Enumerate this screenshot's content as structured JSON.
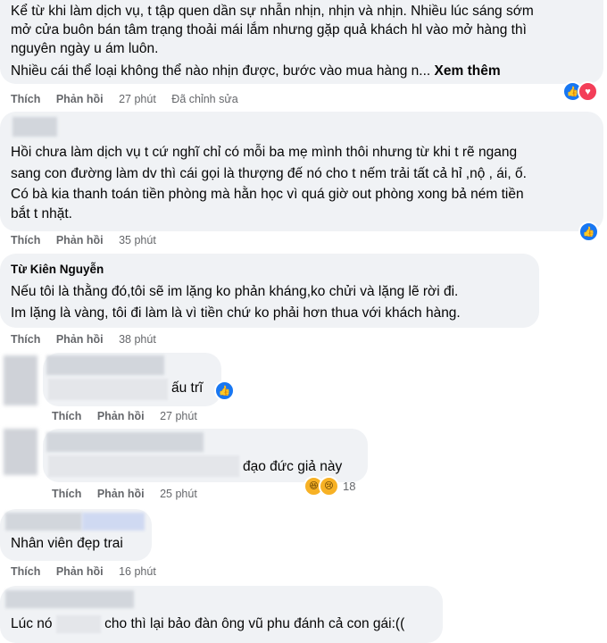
{
  "comments": [
    {
      "lines": [
        "Kể từ khi làm dịch vụ, t tập quen dần sự nhẫn nhịn, nhịn và nhịn. Nhiều lúc sáng sớm",
        "mở cửa buôn bán tâm trạng thoải mái lắm nhưng gặp quả khách hl vào mở hàng thì",
        "nguyên ngày u ám luôn.",
        "Nhiều cái thể loại không thể nào nhịn được, bước vào mua hàng n..."
      ],
      "see_more": "Xem thêm",
      "like": "Thích",
      "reply": "Phản hồi",
      "time": "27 phút",
      "edited": "Đã chỉnh sửa",
      "reactions": [
        "like",
        "love"
      ]
    },
    {
      "lines": [
        "Hồi chưa làm dịch vụ t cứ nghĩ chỉ có mỗi ba mẹ mình thôi nhưng từ khi t rẽ ngang",
        "sang con đường làm dv thì cái gọi là thượng đế nó cho t nếm trải tất cả hỉ ,nộ , ái, ố.",
        "Có bà kia thanh toán tiền phòng mà hằn học vì quá giờ out phòng xong bả ném tiền",
        "bắt t nhặt."
      ],
      "like": "Thích",
      "reply": "Phản hồi",
      "time": "35 phút",
      "reactions": [
        "like"
      ]
    },
    {
      "author": "Từ Kiên Nguyễn",
      "lines": [
        "Nếu tôi là thằng đó,tôi sẽ im lặng ko phản kháng,ko chửi và lặng lẽ rời đi.",
        "Im lặng là vàng, tôi đi làm là vì tiền chứ ko phải hơn thua với khách hàng."
      ],
      "like": "Thích",
      "reply": "Phản hồi",
      "time": "38 phút"
    },
    {
      "lines": [
        "ấu trĩ"
      ],
      "like": "Thích",
      "reply": "Phản hồi",
      "time": "27 phút",
      "reactions": [
        "like"
      ]
    },
    {
      "lines": [
        "đạo đức giả này"
      ],
      "like": "Thích",
      "reply": "Phản hồi",
      "time": "25 phút",
      "reactions": [
        "haha",
        "sad"
      ],
      "reaction_count": "18"
    },
    {
      "lines": [
        "Nhân viên đẹp trai"
      ],
      "like": "Thích",
      "reply": "Phản hồi",
      "time": "16 phút"
    },
    {
      "lines_parts": [
        "Lúc nó",
        "cho thì lại bảo đàn ông vũ phu đánh cả con gái:(("
      ]
    }
  ],
  "colors": {
    "bubble": "#f0f2f5",
    "like_blue": "#1877f2",
    "love_red": "#f33e58",
    "haha_yellow": "#f7b125",
    "meta_gray": "#65676b"
  },
  "icons": {
    "like": "like-reaction-icon",
    "love": "love-reaction-icon",
    "haha": "haha-reaction-icon",
    "sad": "sad-reaction-icon"
  }
}
